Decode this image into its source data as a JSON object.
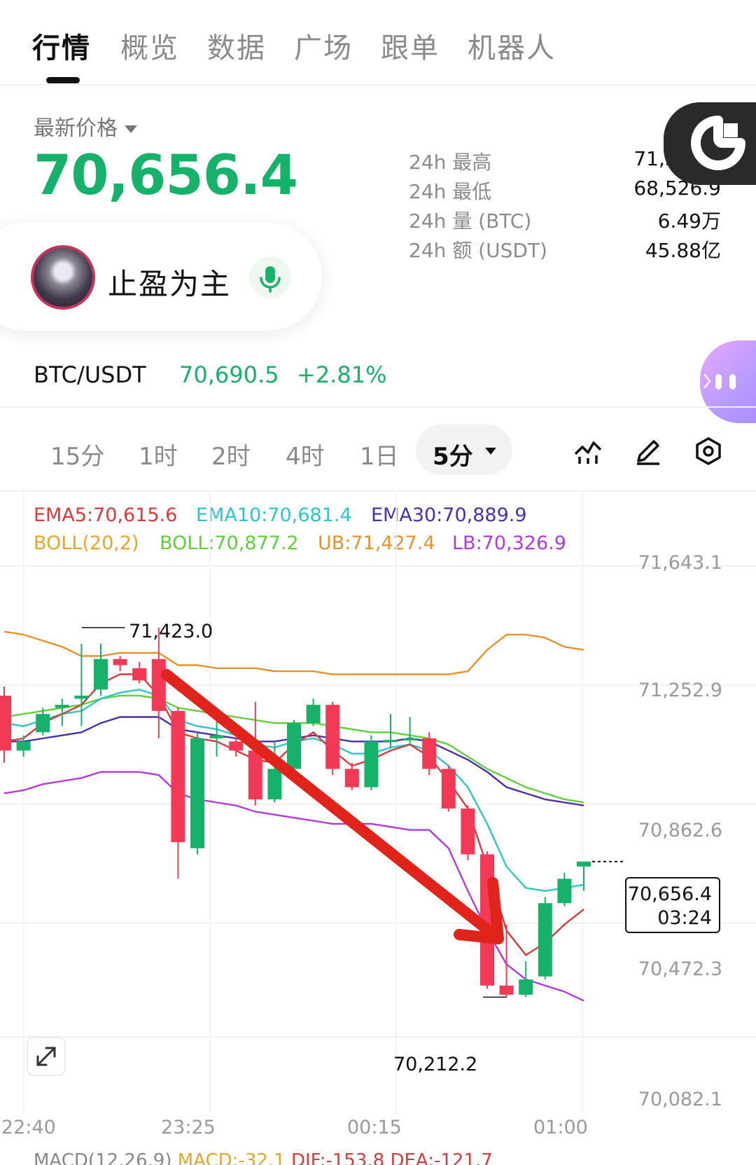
{
  "nav_tabs": [
    "行情",
    "概览",
    "数据",
    "广场",
    "跟单",
    "机器人"
  ],
  "price_header": {
    "label": "最新价格",
    "last_price": "70,656.4"
  },
  "stats": [
    {
      "label": "24h  最高",
      "value": "71,517.8"
    },
    {
      "label": "24h  最低",
      "value": "68,526.9"
    },
    {
      "label": "24h  量 (BTC)",
      "value": "6.49万"
    },
    {
      "label": "24h  额 (USDT)",
      "value": "45.88亿"
    }
  ],
  "user": {
    "name": "止盈为主"
  },
  "pair": {
    "symbol": "BTC/USDT",
    "price": "70,690.5",
    "change": "+2.81%"
  },
  "intervals": [
    "15分",
    "1时",
    "2时",
    "4时",
    "1日"
  ],
  "active_interval": "5分",
  "indicators": {
    "ema5": "EMA5:70,615.6",
    "ema10": "EMA10:70,681.4",
    "ema30": "EMA30:70,889.9",
    "boll_params": "BOLL(20,2)",
    "boll": "BOLL:70,877.2",
    "ub": "UB:71,427.4",
    "lb": "LB:70,326.9"
  },
  "colors": {
    "green": "#16b26a",
    "red": "#f23a57",
    "ema5": "#d83b3b",
    "ema10": "#2cc6c6",
    "ema30": "#4b2fa8",
    "boll_ub": "#e4922c",
    "boll_mid": "#5fd03a",
    "boll_lb": "#b13ad8",
    "arrow": "#e0241c"
  },
  "chart_data": {
    "type": "candlestick",
    "y_ticks": [
      "71,643.1",
      "71,252.9",
      "70,862.6",
      "70,472.3",
      "70,082.1"
    ],
    "x_ticks": [
      "22:40",
      "23:25",
      "00:15",
      "01:00"
    ],
    "high_marker": "71,423.0",
    "low_marker": "70,212.2",
    "last_price_tag": "70,656.4",
    "countdown": "03:24",
    "ylim": [
      70082.1,
      71643.1
    ],
    "candles": [
      {
        "o": 71200,
        "c": 71020,
        "h": 71230,
        "l": 70980
      },
      {
        "o": 71020,
        "c": 71050,
        "h": 71070,
        "l": 71000
      },
      {
        "o": 71080,
        "c": 71140,
        "h": 71160,
        "l": 71070
      },
      {
        "o": 71160,
        "c": 71170,
        "h": 71190,
        "l": 71100
      },
      {
        "o": 71190,
        "c": 71200,
        "h": 71370,
        "l": 71100
      },
      {
        "o": 71220,
        "c": 71320,
        "h": 71370,
        "l": 71200
      },
      {
        "o": 71320,
        "c": 71300,
        "h": 71330,
        "l": 71280
      },
      {
        "o": 71290,
        "c": 71250,
        "h": 71310,
        "l": 71240
      },
      {
        "o": 71320,
        "c": 71150,
        "h": 71423,
        "l": 71060
      },
      {
        "o": 71150,
        "c": 70720,
        "h": 71160,
        "l": 70600
      },
      {
        "o": 70700,
        "c": 71060,
        "h": 71080,
        "l": 70680
      },
      {
        "o": 71060,
        "c": 71070,
        "h": 71120,
        "l": 71000
      },
      {
        "o": 71050,
        "c": 71020,
        "h": 71060,
        "l": 71000
      },
      {
        "o": 71020,
        "c": 70860,
        "h": 71180,
        "l": 70840
      },
      {
        "o": 70860,
        "c": 70960,
        "h": 71050,
        "l": 70850
      },
      {
        "o": 70960,
        "c": 71110,
        "h": 71120,
        "l": 70940
      },
      {
        "o": 71110,
        "c": 71170,
        "h": 71190,
        "l": 71100
      },
      {
        "o": 71170,
        "c": 70960,
        "h": 71180,
        "l": 70940
      },
      {
        "o": 70960,
        "c": 70900,
        "h": 70980,
        "l": 70890
      },
      {
        "o": 70900,
        "c": 71050,
        "h": 71070,
        "l": 70890
      },
      {
        "o": 71050,
        "c": 71055,
        "h": 71140,
        "l": 71030
      },
      {
        "o": 71055,
        "c": 71060,
        "h": 71130,
        "l": 71040
      },
      {
        "o": 71060,
        "c": 70960,
        "h": 71080,
        "l": 70940
      },
      {
        "o": 70960,
        "c": 70830,
        "h": 70970,
        "l": 70820
      },
      {
        "o": 70830,
        "c": 70680,
        "h": 70840,
        "l": 70660
      },
      {
        "o": 70680,
        "c": 70250,
        "h": 70690,
        "l": 70240
      },
      {
        "o": 70250,
        "c": 70220,
        "h": 70450,
        "l": 70212.2
      },
      {
        "o": 70220,
        "c": 70270,
        "h": 70330,
        "l": 70212.2
      },
      {
        "o": 70280,
        "c": 70520,
        "h": 70540,
        "l": 70270
      },
      {
        "o": 70520,
        "c": 70600,
        "h": 70620,
        "l": 70510
      },
      {
        "o": 70640,
        "c": 70656.4,
        "h": 70650,
        "l": 70560
      }
    ],
    "ema5": [
      71050,
      71060,
      71110,
      71140,
      71170,
      71240,
      71270,
      71270,
      71200,
      71080,
      71060,
      71050,
      71020,
      70990,
      70980,
      71040,
      71080,
      71020,
      70970,
      70990,
      71020,
      71040,
      71000,
      70920,
      70830,
      70640,
      70430,
      70350,
      70390,
      70450,
      70500
    ],
    "ema10": [
      71110,
      71100,
      71120,
      71140,
      71150,
      71190,
      71210,
      71220,
      71200,
      71120,
      71100,
      71090,
      71070,
      71040,
      71030,
      71050,
      71060,
      71040,
      71010,
      71010,
      71030,
      71040,
      71020,
      70970,
      70900,
      70780,
      70640,
      70570,
      70560,
      70570,
      70580
    ],
    "ema30": [
      71050,
      71050,
      71060,
      71070,
      71080,
      71110,
      71130,
      71130,
      71130,
      71090,
      71080,
      71070,
      71060,
      71050,
      71050,
      71060,
      71070,
      71060,
      71050,
      71050,
      71050,
      71060,
      71050,
      71020,
      70990,
      70950,
      70900,
      70880,
      70860,
      70850,
      70840
    ],
    "boll_ub": [
      71410,
      71400,
      71380,
      71360,
      71330,
      71330,
      71340,
      71340,
      71340,
      71300,
      71300,
      71290,
      71290,
      71290,
      71280,
      71280,
      71280,
      71270,
      71270,
      71270,
      71270,
      71270,
      71270,
      71270,
      71280,
      71350,
      71400,
      71400,
      71390,
      71360,
      71350
    ],
    "boll_mid": [
      71130,
      71140,
      71150,
      71160,
      71170,
      71190,
      71200,
      71200,
      71190,
      71160,
      71150,
      71140,
      71130,
      71120,
      71110,
      71110,
      71110,
      71100,
      71090,
      71080,
      71080,
      71070,
      71060,
      71040,
      71000,
      70960,
      70930,
      70900,
      70880,
      70860,
      70850
    ],
    "boll_lb": [
      70880,
      70890,
      70910,
      70920,
      70930,
      70950,
      70950,
      70950,
      70940,
      70880,
      70860,
      70850,
      70840,
      70820,
      70810,
      70800,
      70790,
      70780,
      70780,
      70780,
      70770,
      70760,
      70760,
      70700,
      70560,
      70430,
      70320,
      70270,
      70250,
      70230,
      70200
    ]
  },
  "macd": {
    "params": "MACD(12,26,9)",
    "macd": "MACD:-32.1",
    "dif": "DIF:-153.8",
    "dea": "DEA:-121.7"
  }
}
